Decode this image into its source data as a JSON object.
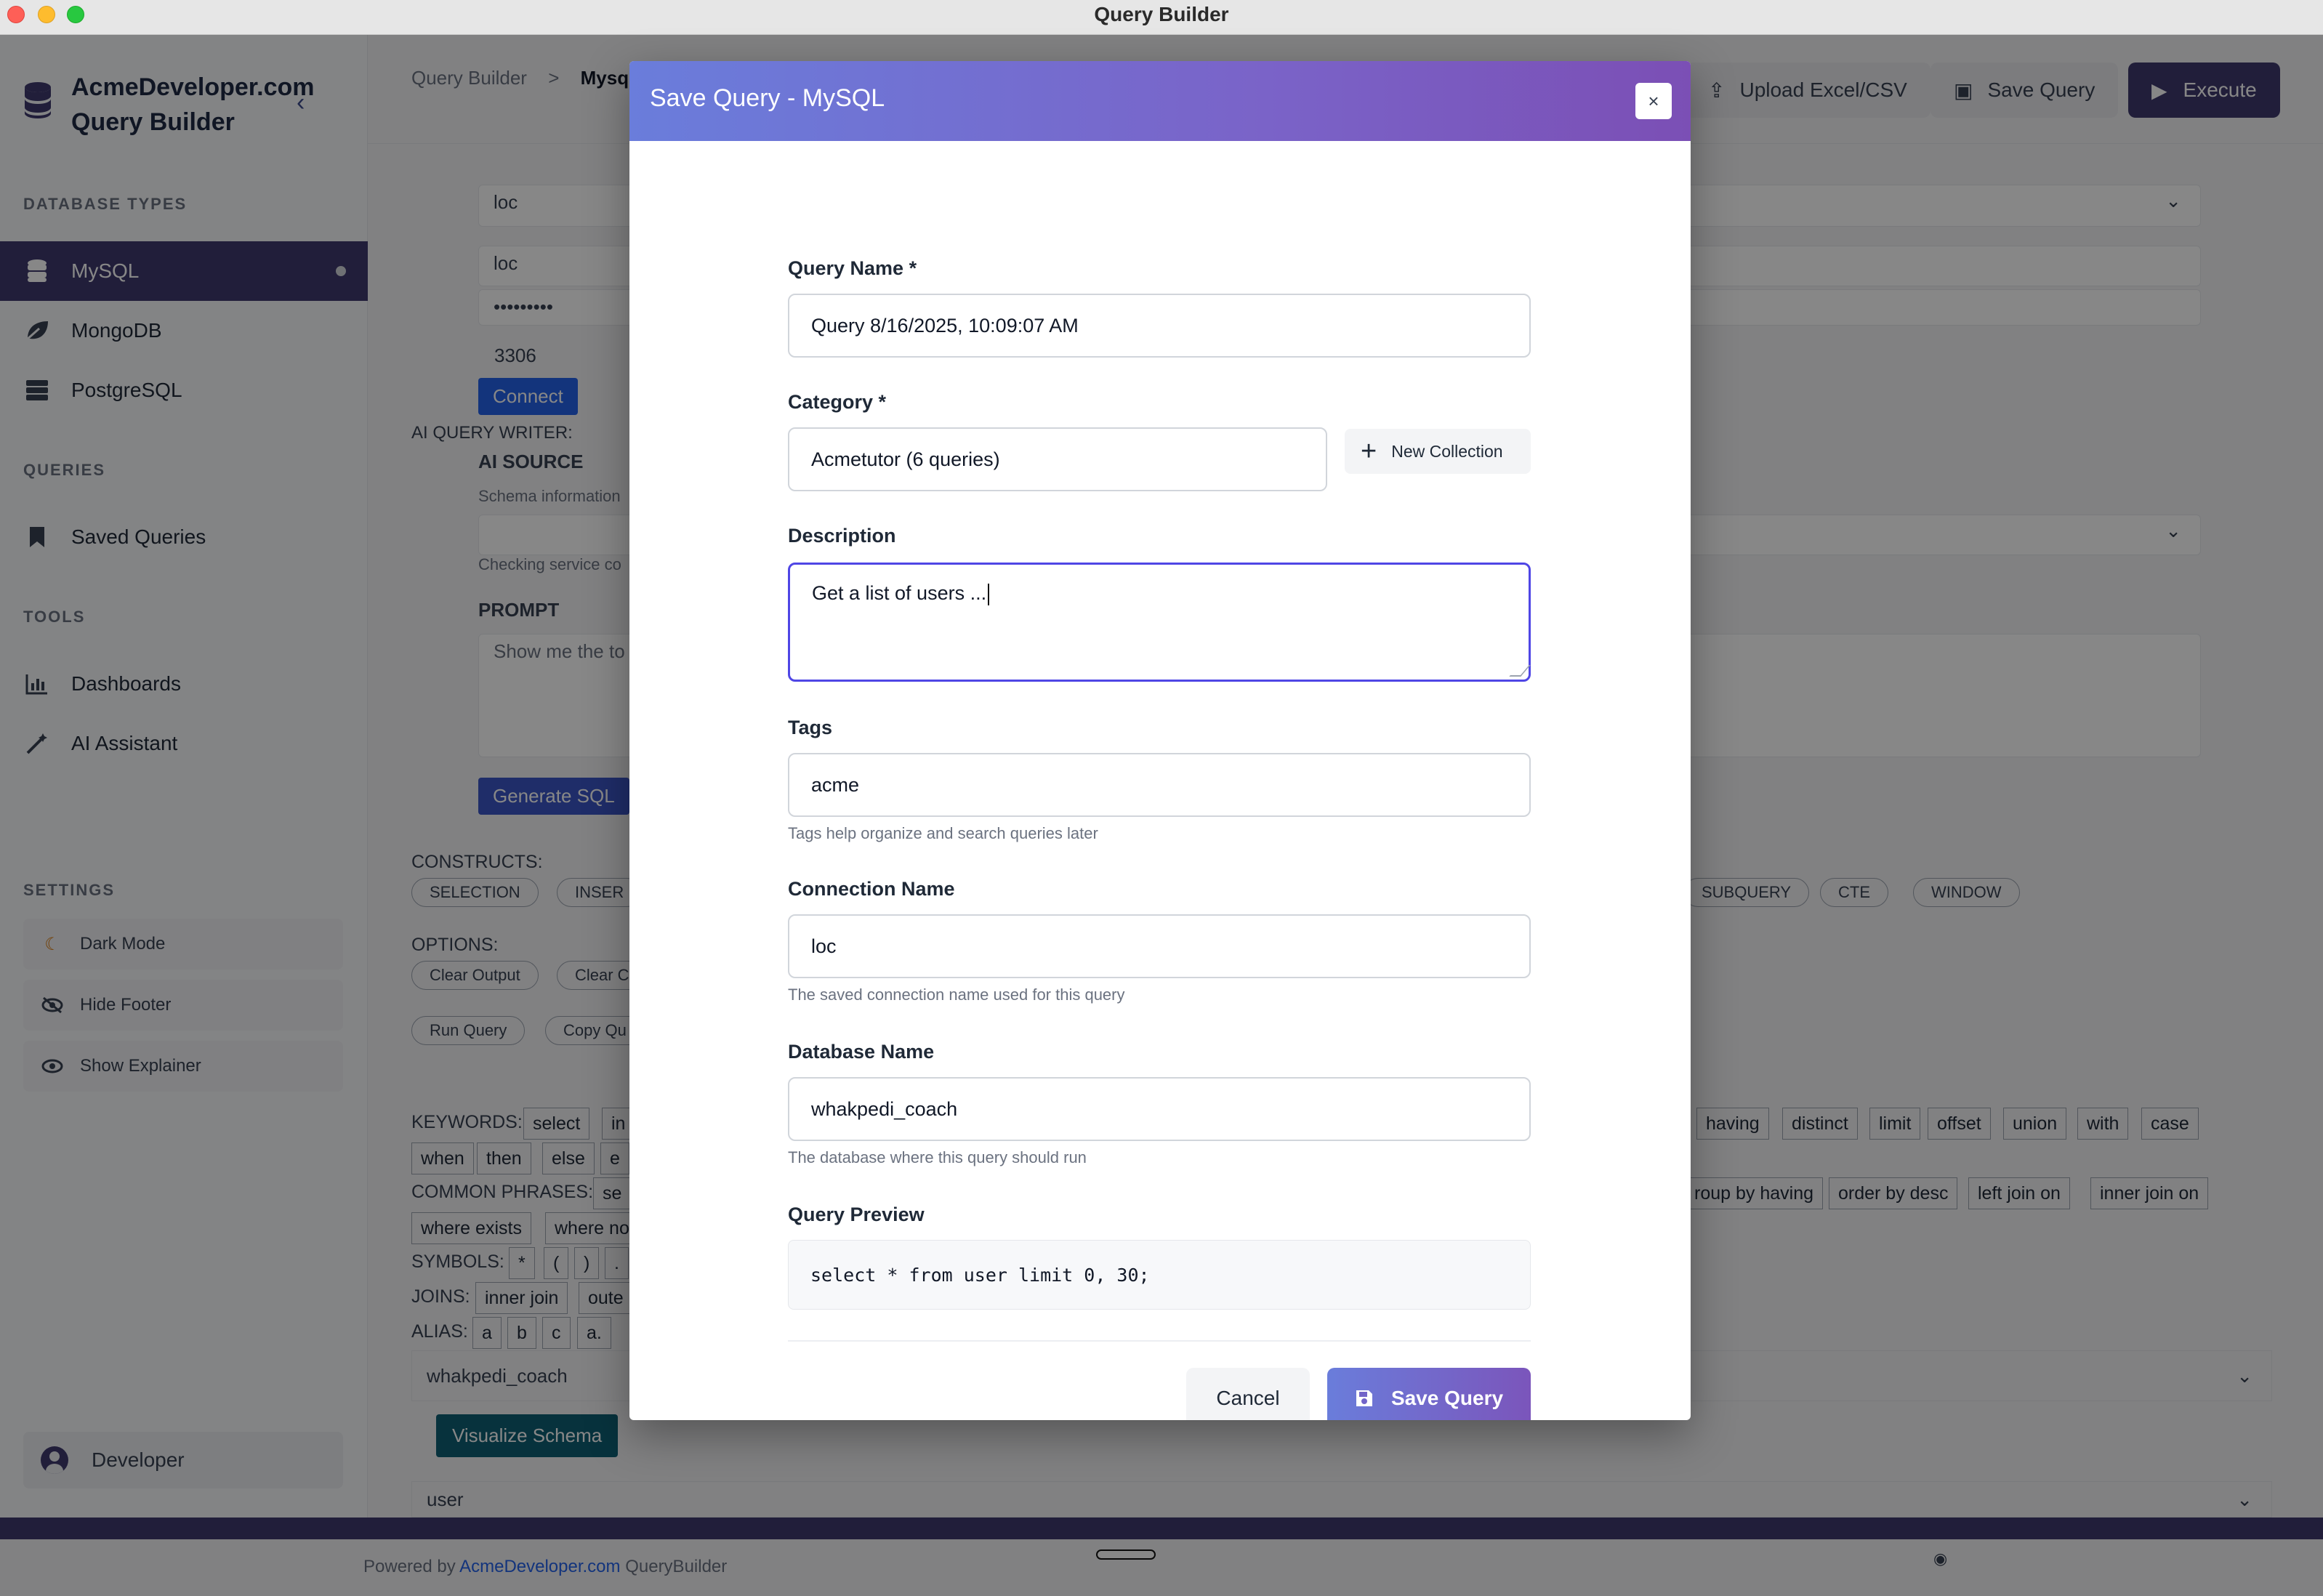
{
  "window": {
    "title": "Query Builder"
  },
  "sidebar": {
    "brand_line1": "AcmeDeveloper.com",
    "brand_line2": "Query Builder",
    "sections": {
      "database_types": "DATABASE TYPES",
      "queries": "QUERIES",
      "tools": "TOOLS",
      "settings": "SETTINGS"
    },
    "db_items": [
      {
        "label": "MySQL",
        "icon": "database-icon",
        "active": true
      },
      {
        "label": "MongoDB",
        "icon": "leaf-icon"
      },
      {
        "label": "PostgreSQL",
        "icon": "server-icon"
      }
    ],
    "query_items": [
      {
        "label": "Saved Queries",
        "icon": "bookmark-icon"
      }
    ],
    "tool_items": [
      {
        "label": "Dashboards",
        "icon": "chart-icon"
      },
      {
        "label": "AI Assistant",
        "icon": "magic-wand-icon"
      }
    ],
    "settings_items": [
      {
        "label": "Dark Mode",
        "icon": "moon-icon"
      },
      {
        "label": "Hide Footer",
        "icon": "eye-slash-icon"
      },
      {
        "label": "Show Explainer",
        "icon": "eye-icon"
      }
    ],
    "user": "Developer"
  },
  "header": {
    "breadcrumb_root": "Query Builder",
    "breadcrumb_sep": ">",
    "breadcrumb_current": "Mysql",
    "upload": "Upload Excel/CSV",
    "save": "Save Query",
    "execute": "Execute"
  },
  "background": {
    "host": "loc",
    "user": "loc",
    "password": "•••••••••",
    "port": "3306",
    "connect": "Connect",
    "ai_writer": "AI QUERY WRITER:",
    "ai_source": "AI SOURCE",
    "schema_info": "Schema information",
    "checking": "Checking service co",
    "prompt": "PROMPT",
    "prompt_text": "Show me the to",
    "generate": "Generate SQL",
    "constructs": "CONSTRUCTS:",
    "construct_chips": [
      "SELECTION",
      "INSER"
    ],
    "construct_chips_right": [
      "SUBQUERY",
      "CTE",
      "WINDOW"
    ],
    "options": "OPTIONS:",
    "option_chips": [
      "Clear Output",
      "Clear C"
    ],
    "run_chips": [
      "Run Query",
      "Copy Qu"
    ],
    "keywords": "KEYWORDS:",
    "keywords_left": [
      "select",
      "in"
    ],
    "keywords_row2": [
      "when",
      "then",
      "else",
      "e"
    ],
    "keywords_right": [
      "having",
      "distinct",
      "limit",
      "offset",
      "union",
      "with",
      "case"
    ],
    "common_phrases": "COMMON PHRASES:",
    "phrases_left": [
      "se"
    ],
    "phrases_row2": [
      "where exists",
      "where no"
    ],
    "phrases_right": [
      "roup by having",
      "order by desc",
      "left join on",
      "inner join on"
    ],
    "symbols": "SYMBOLS:",
    "symbols_items": [
      "*",
      "(",
      ")",
      "."
    ],
    "joins": "JOINS:",
    "joins_items": [
      "inner join",
      "oute"
    ],
    "alias": "ALIAS:",
    "alias_items": [
      "a",
      "b",
      "c",
      "a."
    ],
    "db_row": "whakpedi_coach",
    "visualize": "Visualize Schema",
    "table_row": "user"
  },
  "footer": {
    "powered_prefix": "Powered by ",
    "powered_link": "AcmeDeveloper.com",
    "powered_suffix": " QueryBuilder"
  },
  "modal": {
    "title": "Save Query - MySQL",
    "close": "×",
    "query_name_label": "Query Name *",
    "query_name_value": "Query 8/16/2025, 10:09:07 AM",
    "category_label": "Category *",
    "category_value": "Acmetutor (6 queries)",
    "new_collection": "New Collection",
    "description_label": "Description",
    "description_value": "Get a list of users ...",
    "tags_label": "Tags",
    "tags_value": "acme",
    "tags_hint": "Tags help organize and search queries later",
    "connection_label": "Connection Name",
    "connection_value": "loc",
    "connection_hint": "The saved connection name used for this query",
    "database_label": "Database Name",
    "database_value": "whakpedi_coach",
    "database_hint": "The database where this query should run",
    "preview_label": "Query Preview",
    "preview_sql": "select * from user limit 0, 30;",
    "cancel": "Cancel",
    "save": "Save Query"
  },
  "colors": {
    "accent": "#3f3a6e",
    "modal_gradient_start": "#6a7ddb",
    "modal_gradient_end": "#7b4fb5",
    "focus_border": "#4f46e5"
  }
}
